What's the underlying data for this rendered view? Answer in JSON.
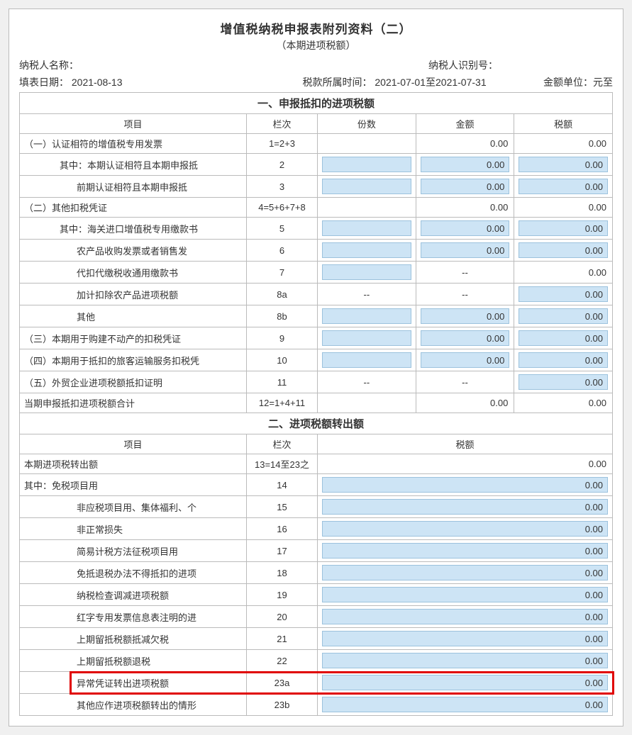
{
  "title": "增值税纳税申报表附列资料（二）",
  "subtitle": "（本期进项税额）",
  "meta": {
    "payer_name_label": "纳税人名称：",
    "payer_name": "",
    "payer_id_label": "纳税人识别号：",
    "payer_id": "",
    "fill_date_label": "填表日期：",
    "fill_date": "2021-08-13",
    "period_label": "税款所属时间：",
    "period": "2021-07-01至2021-07-31",
    "unit_label": "金额单位：元至"
  },
  "headers": {
    "item": "项目",
    "col": "栏次",
    "copies": "份数",
    "amount": "金额",
    "tax": "税额"
  },
  "section1": {
    "title": "一、申报抵扣的进项税额",
    "rows": [
      {
        "item": "（一）认证相符的增值税专用发票",
        "lc": "1=2+3",
        "copies_type": "blank",
        "copies": "",
        "amount_type": "text",
        "amount": "0.00",
        "tax_type": "text",
        "tax": "0.00",
        "indent": 0
      },
      {
        "item": "其中：本期认证相符且本期申报抵",
        "lc": "2",
        "copies_type": "input",
        "copies": "",
        "amount_type": "input",
        "amount": "0.00",
        "tax_type": "input",
        "tax": "0.00",
        "indent": 1
      },
      {
        "item": "前期认证相符且本期申报抵",
        "lc": "3",
        "copies_type": "input",
        "copies": "",
        "amount_type": "input",
        "amount": "0.00",
        "tax_type": "input",
        "tax": "0.00",
        "indent": 2
      },
      {
        "item": "（二）其他扣税凭证",
        "lc": "4=5+6+7+8",
        "copies_type": "blank",
        "copies": "",
        "amount_type": "text",
        "amount": "0.00",
        "tax_type": "text",
        "tax": "0.00",
        "indent": 0
      },
      {
        "item": "其中：海关进口增值税专用缴款书",
        "lc": "5",
        "copies_type": "input",
        "copies": "",
        "amount_type": "input",
        "amount": "0.00",
        "tax_type": "input",
        "tax": "0.00",
        "indent": 1
      },
      {
        "item": "农产品收购发票或者销售发",
        "lc": "6",
        "copies_type": "input",
        "copies": "",
        "amount_type": "input",
        "amount": "0.00",
        "tax_type": "input",
        "tax": "0.00",
        "indent": 2
      },
      {
        "item": "代扣代缴税收通用缴款书",
        "lc": "7",
        "copies_type": "input",
        "copies": "",
        "amount_type": "dash",
        "amount": "--",
        "tax_type": "text",
        "tax": "0.00",
        "indent": 2
      },
      {
        "item": "加计扣除农产品进项税额",
        "lc": "8a",
        "copies_type": "dash",
        "copies": "--",
        "amount_type": "dash",
        "amount": "--",
        "tax_type": "input",
        "tax": "0.00",
        "indent": 2
      },
      {
        "item": "其他",
        "lc": "8b",
        "copies_type": "input",
        "copies": "",
        "amount_type": "input",
        "amount": "0.00",
        "tax_type": "input",
        "tax": "0.00",
        "indent": 2
      },
      {
        "item": "（三）本期用于购建不动产的扣税凭证",
        "lc": "9",
        "copies_type": "input",
        "copies": "",
        "amount_type": "input",
        "amount": "0.00",
        "tax_type": "input",
        "tax": "0.00",
        "indent": 0
      },
      {
        "item": "（四）本期用于抵扣的旅客运输服务扣税凭",
        "lc": "10",
        "copies_type": "input",
        "copies": "",
        "amount_type": "input",
        "amount": "0.00",
        "tax_type": "input",
        "tax": "0.00",
        "indent": 0
      },
      {
        "item": "（五）外贸企业进项税额抵扣证明",
        "lc": "11",
        "copies_type": "dash",
        "copies": "--",
        "amount_type": "dash",
        "amount": "--",
        "tax_type": "input",
        "tax": "0.00",
        "indent": 0
      },
      {
        "item": "当期申报抵扣进项税额合计",
        "lc": "12=1+4+11",
        "copies_type": "blank",
        "copies": "",
        "amount_type": "text",
        "amount": "0.00",
        "tax_type": "text",
        "tax": "0.00",
        "indent": 0
      }
    ]
  },
  "section2": {
    "title": "二、进项税额转出额",
    "rows": [
      {
        "item": "本期进项税转出额",
        "lc": "13=14至23之",
        "tax_type": "text",
        "tax": "0.00",
        "indent": 0
      },
      {
        "item": "其中：免税项目用",
        "lc": "14",
        "tax_type": "input",
        "tax": "0.00",
        "indent": 0
      },
      {
        "item": "非应税项目用、集体福利、个",
        "lc": "15",
        "tax_type": "input",
        "tax": "0.00",
        "indent": 2
      },
      {
        "item": "非正常损失",
        "lc": "16",
        "tax_type": "input",
        "tax": "0.00",
        "indent": 2
      },
      {
        "item": "简易计税方法征税项目用",
        "lc": "17",
        "tax_type": "input",
        "tax": "0.00",
        "indent": 2
      },
      {
        "item": "免抵退税办法不得抵扣的进项",
        "lc": "18",
        "tax_type": "input",
        "tax": "0.00",
        "indent": 2
      },
      {
        "item": "纳税检查调减进项税额",
        "lc": "19",
        "tax_type": "input",
        "tax": "0.00",
        "indent": 2
      },
      {
        "item": "红字专用发票信息表注明的进",
        "lc": "20",
        "tax_type": "input",
        "tax": "0.00",
        "indent": 2
      },
      {
        "item": "上期留抵税额抵减欠税",
        "lc": "21",
        "tax_type": "input",
        "tax": "0.00",
        "indent": 2
      },
      {
        "item": "上期留抵税额退税",
        "lc": "22",
        "tax_type": "input",
        "tax": "0.00",
        "indent": 2
      },
      {
        "item": "异常凭证转出进项税额",
        "lc": "23a",
        "tax_type": "input",
        "tax": "0.00",
        "indent": 2,
        "highlight": true
      },
      {
        "item": "其他应作进项税额转出的情形",
        "lc": "23b",
        "tax_type": "input",
        "tax": "0.00",
        "indent": 2
      }
    ]
  }
}
